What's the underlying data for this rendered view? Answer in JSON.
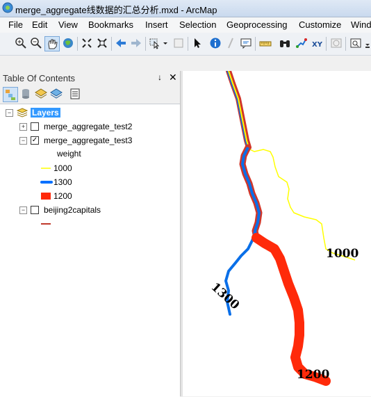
{
  "window": {
    "title": "merge_aggregate线数据的汇总分析.mxd - ArcMap"
  },
  "menu": {
    "items": [
      "File",
      "Edit",
      "View",
      "Bookmarks",
      "Insert",
      "Selection",
      "Geoprocessing",
      "Customize",
      "Wind"
    ]
  },
  "toolbar": {
    "icons": [
      "zoom-in-icon",
      "zoom-out-icon",
      "pan-icon",
      "full-extent-icon",
      "fixed-zoom-in-icon",
      "fixed-zoom-out-icon",
      "back-icon",
      "forward-icon",
      "select-features-icon",
      "clear-selection-icon",
      "select-elements-icon",
      "identify-icon",
      "hyperlink-icon",
      "html-popup-icon",
      "measure-icon",
      "find-icon",
      "find-route-icon",
      "go-to-xy-icon",
      "time-slider-icon",
      "create-viewer-icon"
    ]
  },
  "toc": {
    "title": "Table Of Contents",
    "pin": "↓",
    "close": "✕",
    "root_label": "Layers",
    "layers": [
      {
        "name": "merge_aggregate_test2",
        "checked": false,
        "expanded": false
      },
      {
        "name": "merge_aggregate_test3",
        "checked": true,
        "expanded": true
      },
      {
        "name": "beijing2capitals",
        "checked": false,
        "expanded": true
      }
    ],
    "legend": {
      "field": "weight",
      "classes": [
        {
          "label": "1000",
          "color": "#ffff00"
        },
        {
          "label": "1300",
          "color": "#0070ff"
        },
        {
          "label": "1200",
          "color": "#ff2a0a"
        }
      ]
    },
    "beijing_symbol_color": "#c0392b"
  },
  "map": {
    "labels": {
      "l1000": "1000",
      "l1300": "1300",
      "l1200": "1200"
    },
    "colors": {
      "yellow": "#ffff00",
      "blue": "#0a6fe8",
      "red": "#ff2a0a",
      "outline_red": "#d0362a"
    }
  }
}
